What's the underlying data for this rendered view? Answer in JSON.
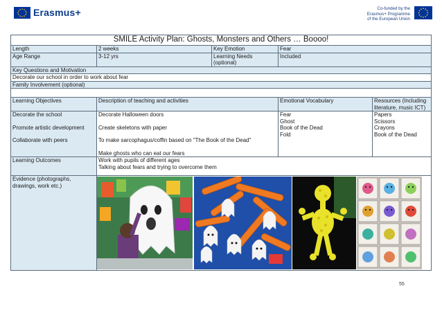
{
  "header": {
    "erasmus_label": "Erasmus+",
    "cofund_line1": "Co-funded by the",
    "cofund_line2": "Erasmus+ Programme",
    "cofund_line3": "of the European Union"
  },
  "plan": {
    "title": "SMILE Activity Plan: Ghosts, Monsters and Others … Boooo!",
    "length_label": "Length",
    "length_value": "2 weeks",
    "key_emotion_label": "Key Emotion",
    "key_emotion_value": "Fear",
    "age_range_label": "Age Range",
    "age_range_value": "3-12 yrs",
    "learning_needs_label": "Learning Needs (optional)",
    "learning_needs_value": "Included",
    "key_questions_label": "Key Questions and Motivation",
    "key_questions_value": "Decorate our school in order to work about fear",
    "family_label": "Family Involvement (optional)",
    "col_objectives": "Learning Objectives",
    "col_description": "Description of teaching and activities",
    "col_emotional": "Emotional Vocabulary",
    "col_resources": "Resources (Including literature, music ICT)",
    "objectives": [
      "Decorate the school",
      "Promote artistic development",
      "Collaborate with peers"
    ],
    "descriptions": [
      "Decorate Halloween doors",
      "Create skeletons with paper",
      "To make sarcophagus/coffin based on \"The Book of the Dead\"",
      "Make ghosts who can eat our fears"
    ],
    "vocabulary": [
      "Fear",
      "Ghost",
      "Book of the Dead",
      "Fold"
    ],
    "resources": [
      "Papers",
      "Scissors",
      "Crayons",
      "Book of the Dead"
    ],
    "outcomes_label": "Learning Outcomes",
    "outcomes": [
      "Work with pupils of different ages",
      "Talking about fears and trying to overcome them"
    ],
    "evidence_label": "Evidence (photographs, drawings, work etc.)"
  },
  "page_number": "55",
  "colors": {
    "header_fill": "#dbe9f3",
    "border": "#5a6b7b",
    "eu_blue": "#003399",
    "eu_star": "#ffcc00"
  }
}
